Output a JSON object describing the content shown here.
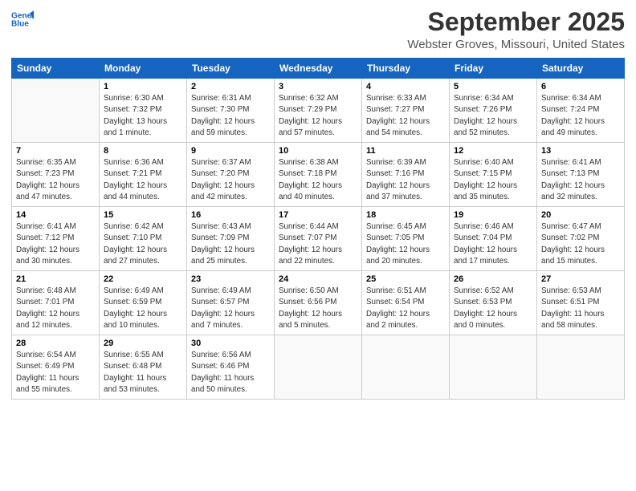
{
  "logo": {
    "line1": "General",
    "line2": "Blue"
  },
  "title": "September 2025",
  "location": "Webster Groves, Missouri, United States",
  "headers": [
    "Sunday",
    "Monday",
    "Tuesday",
    "Wednesday",
    "Thursday",
    "Friday",
    "Saturday"
  ],
  "weeks": [
    [
      {
        "day": "",
        "content": ""
      },
      {
        "day": "1",
        "content": "Sunrise: 6:30 AM\nSunset: 7:32 PM\nDaylight: 13 hours\nand 1 minute."
      },
      {
        "day": "2",
        "content": "Sunrise: 6:31 AM\nSunset: 7:30 PM\nDaylight: 12 hours\nand 59 minutes."
      },
      {
        "day": "3",
        "content": "Sunrise: 6:32 AM\nSunset: 7:29 PM\nDaylight: 12 hours\nand 57 minutes."
      },
      {
        "day": "4",
        "content": "Sunrise: 6:33 AM\nSunset: 7:27 PM\nDaylight: 12 hours\nand 54 minutes."
      },
      {
        "day": "5",
        "content": "Sunrise: 6:34 AM\nSunset: 7:26 PM\nDaylight: 12 hours\nand 52 minutes."
      },
      {
        "day": "6",
        "content": "Sunrise: 6:34 AM\nSunset: 7:24 PM\nDaylight: 12 hours\nand 49 minutes."
      }
    ],
    [
      {
        "day": "7",
        "content": "Sunrise: 6:35 AM\nSunset: 7:23 PM\nDaylight: 12 hours\nand 47 minutes."
      },
      {
        "day": "8",
        "content": "Sunrise: 6:36 AM\nSunset: 7:21 PM\nDaylight: 12 hours\nand 44 minutes."
      },
      {
        "day": "9",
        "content": "Sunrise: 6:37 AM\nSunset: 7:20 PM\nDaylight: 12 hours\nand 42 minutes."
      },
      {
        "day": "10",
        "content": "Sunrise: 6:38 AM\nSunset: 7:18 PM\nDaylight: 12 hours\nand 40 minutes."
      },
      {
        "day": "11",
        "content": "Sunrise: 6:39 AM\nSunset: 7:16 PM\nDaylight: 12 hours\nand 37 minutes."
      },
      {
        "day": "12",
        "content": "Sunrise: 6:40 AM\nSunset: 7:15 PM\nDaylight: 12 hours\nand 35 minutes."
      },
      {
        "day": "13",
        "content": "Sunrise: 6:41 AM\nSunset: 7:13 PM\nDaylight: 12 hours\nand 32 minutes."
      }
    ],
    [
      {
        "day": "14",
        "content": "Sunrise: 6:41 AM\nSunset: 7:12 PM\nDaylight: 12 hours\nand 30 minutes."
      },
      {
        "day": "15",
        "content": "Sunrise: 6:42 AM\nSunset: 7:10 PM\nDaylight: 12 hours\nand 27 minutes."
      },
      {
        "day": "16",
        "content": "Sunrise: 6:43 AM\nSunset: 7:09 PM\nDaylight: 12 hours\nand 25 minutes."
      },
      {
        "day": "17",
        "content": "Sunrise: 6:44 AM\nSunset: 7:07 PM\nDaylight: 12 hours\nand 22 minutes."
      },
      {
        "day": "18",
        "content": "Sunrise: 6:45 AM\nSunset: 7:05 PM\nDaylight: 12 hours\nand 20 minutes."
      },
      {
        "day": "19",
        "content": "Sunrise: 6:46 AM\nSunset: 7:04 PM\nDaylight: 12 hours\nand 17 minutes."
      },
      {
        "day": "20",
        "content": "Sunrise: 6:47 AM\nSunset: 7:02 PM\nDaylight: 12 hours\nand 15 minutes."
      }
    ],
    [
      {
        "day": "21",
        "content": "Sunrise: 6:48 AM\nSunset: 7:01 PM\nDaylight: 12 hours\nand 12 minutes."
      },
      {
        "day": "22",
        "content": "Sunrise: 6:49 AM\nSunset: 6:59 PM\nDaylight: 12 hours\nand 10 minutes."
      },
      {
        "day": "23",
        "content": "Sunrise: 6:49 AM\nSunset: 6:57 PM\nDaylight: 12 hours\nand 7 minutes."
      },
      {
        "day": "24",
        "content": "Sunrise: 6:50 AM\nSunset: 6:56 PM\nDaylight: 12 hours\nand 5 minutes."
      },
      {
        "day": "25",
        "content": "Sunrise: 6:51 AM\nSunset: 6:54 PM\nDaylight: 12 hours\nand 2 minutes."
      },
      {
        "day": "26",
        "content": "Sunrise: 6:52 AM\nSunset: 6:53 PM\nDaylight: 12 hours\nand 0 minutes."
      },
      {
        "day": "27",
        "content": "Sunrise: 6:53 AM\nSunset: 6:51 PM\nDaylight: 11 hours\nand 58 minutes."
      }
    ],
    [
      {
        "day": "28",
        "content": "Sunrise: 6:54 AM\nSunset: 6:49 PM\nDaylight: 11 hours\nand 55 minutes."
      },
      {
        "day": "29",
        "content": "Sunrise: 6:55 AM\nSunset: 6:48 PM\nDaylight: 11 hours\nand 53 minutes."
      },
      {
        "day": "30",
        "content": "Sunrise: 6:56 AM\nSunset: 6:46 PM\nDaylight: 11 hours\nand 50 minutes."
      },
      {
        "day": "",
        "content": ""
      },
      {
        "day": "",
        "content": ""
      },
      {
        "day": "",
        "content": ""
      },
      {
        "day": "",
        "content": ""
      }
    ]
  ]
}
